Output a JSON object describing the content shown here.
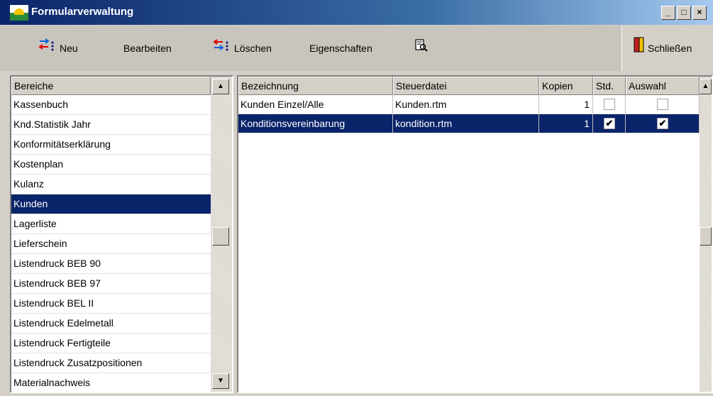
{
  "window": {
    "title": "Formularverwaltung"
  },
  "toolbar": {
    "new_label": "Neu",
    "edit_label": "Bearbeiten",
    "delete_label": "Löschen",
    "properties_label": "Eigenschaften",
    "preview_icon": "print-preview-icon",
    "close_label": "Schließen"
  },
  "areas": {
    "header": "Bereiche",
    "items": [
      "Kassenbuch",
      "Knd.Statistik Jahr",
      "Konformitätserklärung",
      "Kostenplan",
      "Kulanz",
      "Kunden",
      "Lagerliste",
      "Lieferschein",
      "Listendruck BEB 90",
      "Listendruck BEB 97",
      "Listendruck BEL II",
      "Listendruck Edelmetall",
      "Listendruck Fertigteile",
      "Listendruck Zusatzpositionen",
      "Materialnachweis"
    ],
    "selected_index": 5
  },
  "forms": {
    "columns": [
      "Bezeichnung",
      "Steuerdatei",
      "Kopien",
      "Std.",
      "Auswahl"
    ],
    "rows": [
      {
        "bezeichnung": "Kunden Einzel/Alle",
        "steuerdatei": "Kunden.rtm",
        "kopien": "1",
        "std": false,
        "auswahl": false,
        "selected": false
      },
      {
        "bezeichnung": "Konditionsvereinbarung",
        "steuerdatei": "kondition.rtm",
        "kopien": "1",
        "std": true,
        "auswahl": true,
        "selected": true
      }
    ]
  },
  "colors": {
    "selection": "#0a246a",
    "face": "#d4d0c8"
  }
}
